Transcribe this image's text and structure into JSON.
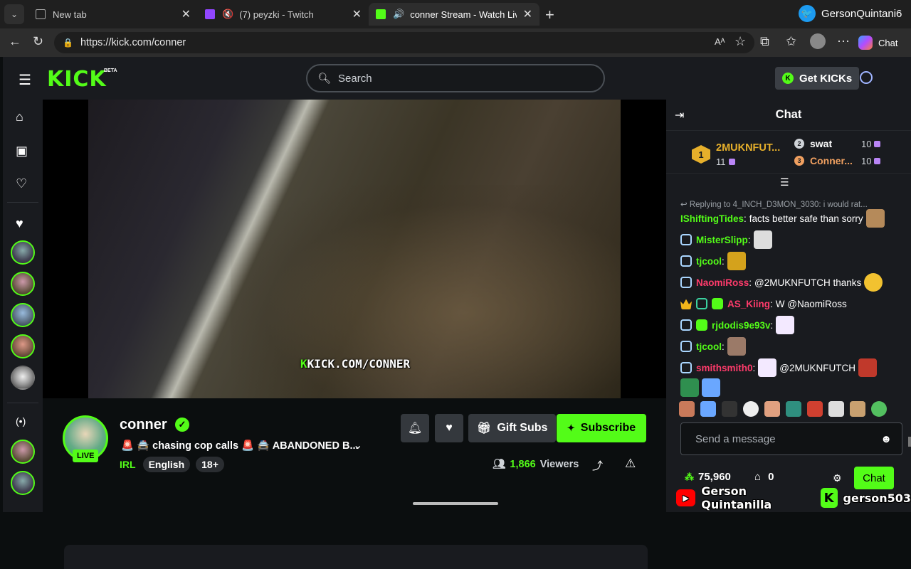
{
  "browser": {
    "tabs": [
      {
        "title": "New tab",
        "active": false
      },
      {
        "title": "(7) peyzki - Twitch",
        "active": false
      },
      {
        "title": "conner Stream - Watch Live o",
        "active": true
      }
    ],
    "url": "https://kick.com/conner",
    "twitter_user": "GersonQuintani6",
    "copilot_label": "Chat"
  },
  "kick": {
    "logo": "KICK",
    "beta": "BETA",
    "search_placeholder": "Search",
    "get_kicks": "Get KICKs"
  },
  "video": {
    "watermark_k": "K",
    "watermark": "KICK.COM/CONNER"
  },
  "stream": {
    "name": "conner",
    "live": "LIVE",
    "title": "🚨 🚔 chasing cop calls 🚨 🚔 ABANDONED B...",
    "category": "IRL",
    "tags": [
      "English",
      "18+"
    ],
    "gift_subs": "Gift Subs",
    "subscribe": "Subscribe",
    "viewers_count": "1,866",
    "viewers_label": "Viewers"
  },
  "chat": {
    "title": "Chat",
    "leaderboard": {
      "first": {
        "rank": "1",
        "name": "2MUKNFUT...",
        "count": "11"
      },
      "second": {
        "rank": "2",
        "name": "swat",
        "count": "10"
      },
      "third": {
        "rank": "3",
        "name": "Conner...",
        "count": "10"
      }
    },
    "reply_line": "Replying to 4_INCH_D3MON_3030: i would rat...",
    "messages": [
      {
        "user": "IShiftingTides",
        "color": "#53fc18",
        "text": "facts better safe than sorry"
      },
      {
        "user": "MisterSlipp",
        "color": "#53fc18",
        "text": ""
      },
      {
        "user": "tjcool",
        "color": "#53fc18",
        "text": ""
      },
      {
        "user": "NaomiRoss",
        "color": "#ff3b6b",
        "text": "@2MUKNFUTCH thanks"
      },
      {
        "user": "AS_Kiing",
        "color": "#ff3b6b",
        "text": "W @NaomiRoss"
      },
      {
        "user": "rjdodis9e93v",
        "color": "#53fc18",
        "text": ""
      },
      {
        "user": "tjcool",
        "color": "#53fc18",
        "text": ""
      },
      {
        "user": "smithsmith0",
        "color": "#ff3b6b",
        "text": "@2MUKNFUTCH"
      }
    ],
    "input_placeholder": "Send a message",
    "points": "75,960",
    "store_count": "0",
    "chat_button": "Chat"
  },
  "overlay": {
    "youtube_name": "Gerson Quintanilla",
    "kick_name": "gerson503"
  },
  "colors": {
    "kick_green": "#53fc18",
    "bg": "#0b0e0f",
    "panel": "#191b1f"
  }
}
